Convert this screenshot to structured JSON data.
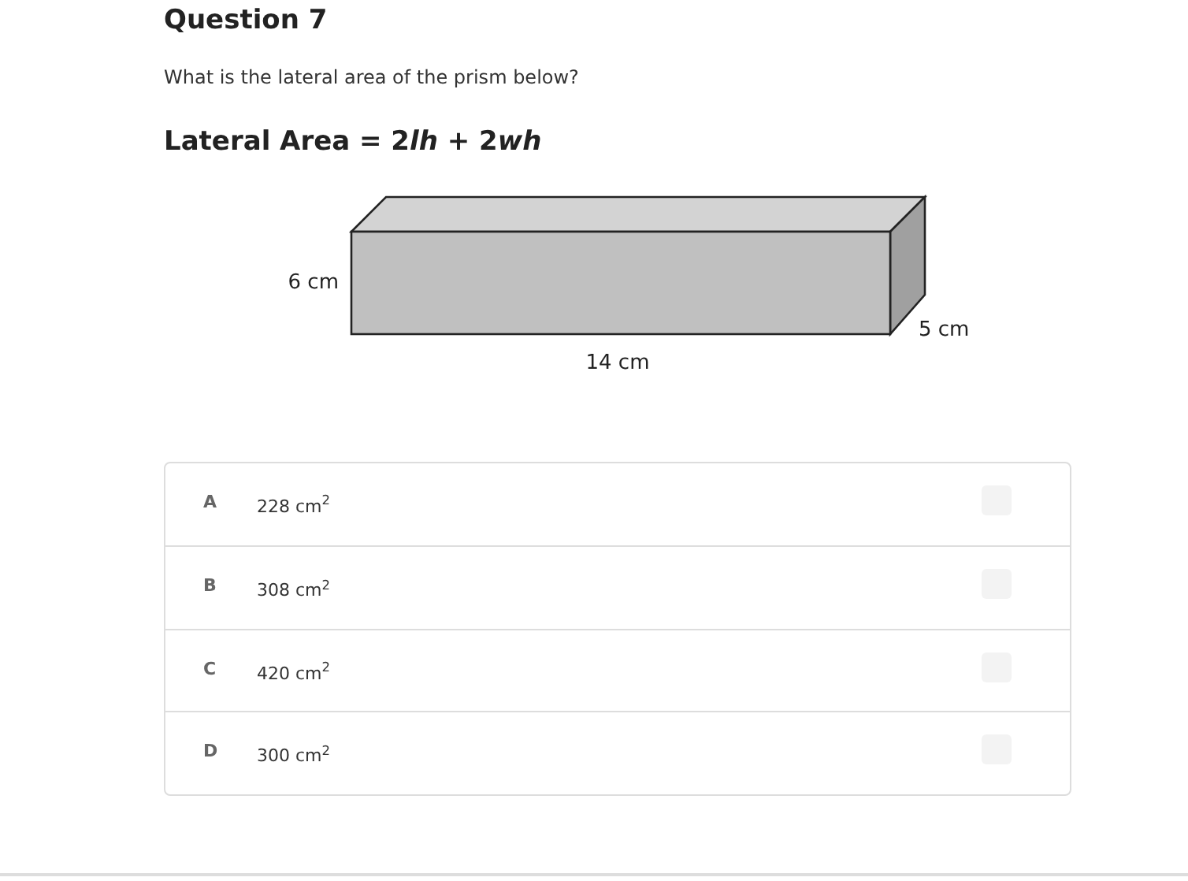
{
  "title": "Question 7",
  "prompt": "What is the lateral area of the prism below?",
  "formula": [
    {
      "text": "Lateral Area = 2",
      "italic": false
    },
    {
      "text": "lh",
      "italic": true
    },
    {
      "text": " + 2",
      "italic": false
    },
    {
      "text": "wh",
      "italic": true
    }
  ],
  "figure": {
    "labels": [
      {
        "kind": "height",
        "text": "6 cm"
      },
      {
        "kind": "length",
        "text": "14 cm"
      },
      {
        "kind": "depth",
        "text": "5 cm"
      }
    ]
  },
  "choices": [
    {
      "letter": "A",
      "text": "228 cm$^{2}$",
      "checked": false
    },
    {
      "letter": "B",
      "text": "308 cm$^{2}$",
      "checked": false
    },
    {
      "letter": "C",
      "text": "420 cm$^{2}$",
      "checked": false
    },
    {
      "letter": "D",
      "text": "300 cm$^{2}$",
      "checked": false
    }
  ]
}
